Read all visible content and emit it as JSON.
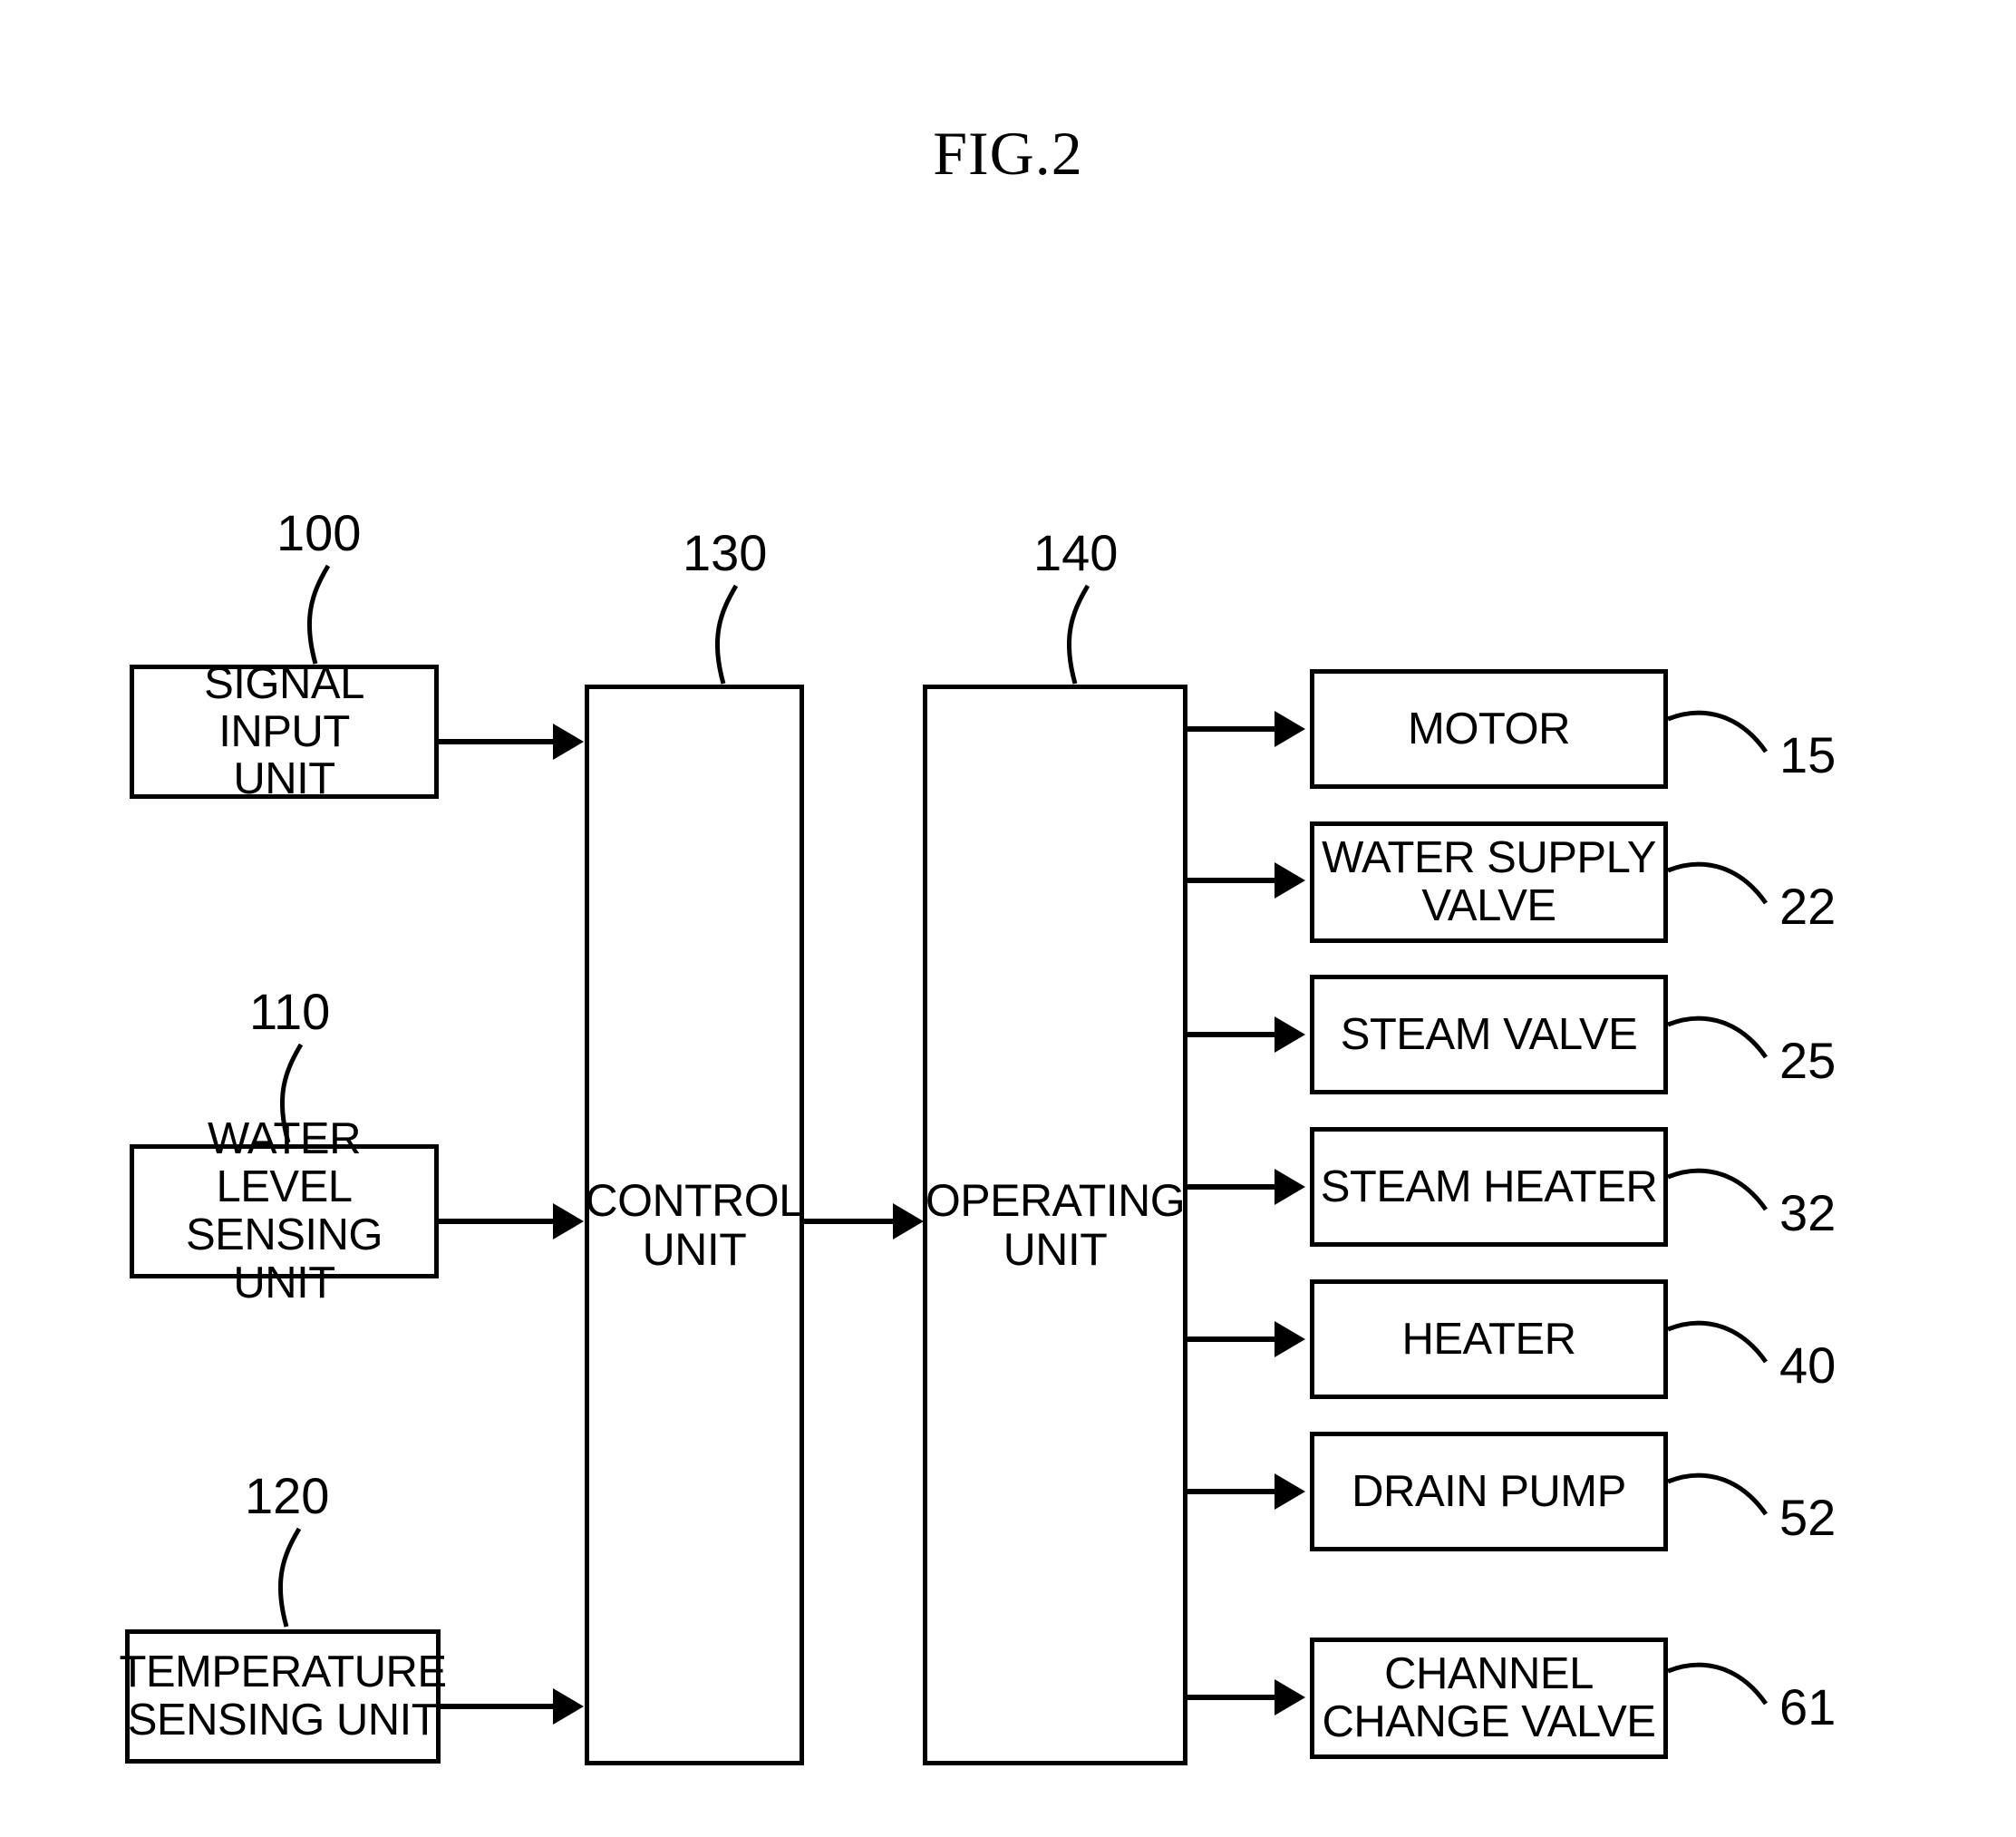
{
  "figure": {
    "title": "FIG.2",
    "accent_color": "#000000",
    "background_color": "#ffffff"
  },
  "inputs": [
    {
      "label": "SIGNAL INPUT\nUNIT",
      "ref": "100"
    },
    {
      "label": "WATER LEVEL\nSENSING UNIT",
      "ref": "110"
    },
    {
      "label": "TEMPERATURE\nSENSING UNIT",
      "ref": "120"
    }
  ],
  "core": [
    {
      "label": "CONTROL\nUNIT",
      "ref": "130"
    },
    {
      "label": "OPERATING\nUNIT",
      "ref": "140"
    }
  ],
  "outputs": [
    {
      "label": "MOTOR",
      "ref": "15"
    },
    {
      "label": "WATER SUPPLY\nVALVE",
      "ref": "22"
    },
    {
      "label": "STEAM VALVE",
      "ref": "25"
    },
    {
      "label": "STEAM HEATER",
      "ref": "32"
    },
    {
      "label": "HEATER",
      "ref": "40"
    },
    {
      "label": "DRAIN PUMP",
      "ref": "52"
    },
    {
      "label": "CHANNEL\nCHANGE VALVE",
      "ref": "61"
    }
  ]
}
